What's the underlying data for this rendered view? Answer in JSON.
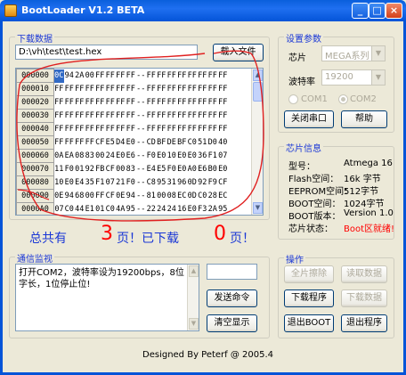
{
  "window": {
    "title": "BootLoader V1.2 BETA"
  },
  "download": {
    "group_title": "下载数据",
    "file_path": "D:\\vh\\test\\test.hex",
    "load_button": "载入文件",
    "rows": [
      {
        "addr": "000000",
        "cells": [
          "0C",
          "94",
          "2A",
          "00",
          "FF",
          "FF",
          "FF",
          "FF",
          "--",
          "FF",
          "FF",
          "FF",
          "FF",
          "FF",
          "FF",
          "FF",
          "FF"
        ]
      },
      {
        "addr": "000010",
        "cells": [
          "FF",
          "FF",
          "FF",
          "FF",
          "FF",
          "FF",
          "FF",
          "FF",
          "--",
          "FF",
          "FF",
          "FF",
          "FF",
          "FF",
          "FF",
          "FF",
          "FF"
        ]
      },
      {
        "addr": "000020",
        "cells": [
          "FF",
          "FF",
          "FF",
          "FF",
          "FF",
          "FF",
          "FF",
          "FF",
          "--",
          "FF",
          "FF",
          "FF",
          "FF",
          "FF",
          "FF",
          "FF",
          "FF"
        ]
      },
      {
        "addr": "000030",
        "cells": [
          "FF",
          "FF",
          "FF",
          "FF",
          "FF",
          "FF",
          "FF",
          "FF",
          "--",
          "FF",
          "FF",
          "FF",
          "FF",
          "FF",
          "FF",
          "FF",
          "FF"
        ]
      },
      {
        "addr": "000040",
        "cells": [
          "FF",
          "FF",
          "FF",
          "FF",
          "FF",
          "FF",
          "FF",
          "FF",
          "--",
          "FF",
          "FF",
          "FF",
          "FF",
          "FF",
          "FF",
          "FF",
          "FF"
        ]
      },
      {
        "addr": "000050",
        "cells": [
          "FF",
          "FF",
          "FF",
          "FF",
          "CF",
          "E5",
          "D4",
          "E0",
          "--",
          "CD",
          "BF",
          "DE",
          "BF",
          "C0",
          "51",
          "D0",
          "40"
        ]
      },
      {
        "addr": "000060",
        "cells": [
          "0A",
          "EA",
          "08",
          "83",
          "00",
          "24",
          "E0",
          "E6",
          "--",
          "F0",
          "E0",
          "10",
          "E0",
          "E0",
          "36",
          "F1",
          "07"
        ]
      },
      {
        "addr": "000070",
        "cells": [
          "11",
          "F0",
          "01",
          "92",
          "FB",
          "CF",
          "00",
          "83",
          "--",
          "E4",
          "E5",
          "F0",
          "E0",
          "A0",
          "E6",
          "B0",
          "E0"
        ]
      },
      {
        "addr": "000080",
        "cells": [
          "10",
          "E0",
          "E4",
          "35",
          "F1",
          "07",
          "21",
          "F0",
          "--",
          "C8",
          "95",
          "31",
          "96",
          "0D",
          "92",
          "F9",
          "CF"
        ]
      },
      {
        "addr": "000090",
        "cells": [
          "0E",
          "94",
          "68",
          "00",
          "FF",
          "CF",
          "0E",
          "94",
          "--",
          "81",
          "00",
          "08",
          "EC",
          "0D",
          "C0",
          "28",
          "EC"
        ]
      },
      {
        "addr": "0000A0",
        "cells": [
          "07",
          "C0",
          "44",
          "E1",
          "01",
          "C0",
          "4A",
          "95",
          "--",
          "22",
          "24",
          "24",
          "16",
          "E0",
          "F3",
          "2A",
          "95"
        ]
      }
    ]
  },
  "progress": {
    "total_label": "总共有",
    "total_pages": "3",
    "pages_downloaded_label": "页！已下载",
    "downloaded_pages": "0",
    "page_suffix": "页！"
  },
  "comm": {
    "group_title": "通信监视",
    "log": "打开COM2，波特率设为19200bps，8位字长，1位停止位!",
    "send_input": "",
    "send_button": "发送命令",
    "clear_button": "清空显示"
  },
  "settings": {
    "group_title": "设置参数",
    "chip_label": "芯片",
    "chip_value": "MEGA系列",
    "baud_label": "波特率",
    "baud_value": "19200",
    "com1_label": "COM1",
    "com2_label": "COM2",
    "close_port_button": "关闭串口",
    "help_button": "帮助"
  },
  "chip_info": {
    "group_title": "芯片信息",
    "rows": [
      {
        "label": "型号：",
        "value": "Atmega 16"
      },
      {
        "label": "Flash空间：",
        "value": "16k 字节"
      },
      {
        "label": "EEPROM空间：",
        "value": "512字节"
      },
      {
        "label": "BOOT空间：",
        "value": "1024字节"
      },
      {
        "label": "BOOT版本：",
        "value": "Version 1.0"
      },
      {
        "label": "芯片状态：",
        "value": "Boot区就绪!"
      }
    ],
    "status_color": "#ff0000"
  },
  "operations": {
    "group_title": "操作",
    "full_erase": "全片擦除",
    "read_data": "读取数据",
    "download_program": "下载程序",
    "download_data": "下载数据",
    "exit_boot": "退出BOOT",
    "exit_program": "退出程序"
  },
  "footer": {
    "credit": "Designed By Peterf  @  2005.4"
  },
  "colors": {
    "accent_blue": "#1a37d6",
    "red": "#ff0000",
    "title_bar": "#0a5fdc"
  }
}
